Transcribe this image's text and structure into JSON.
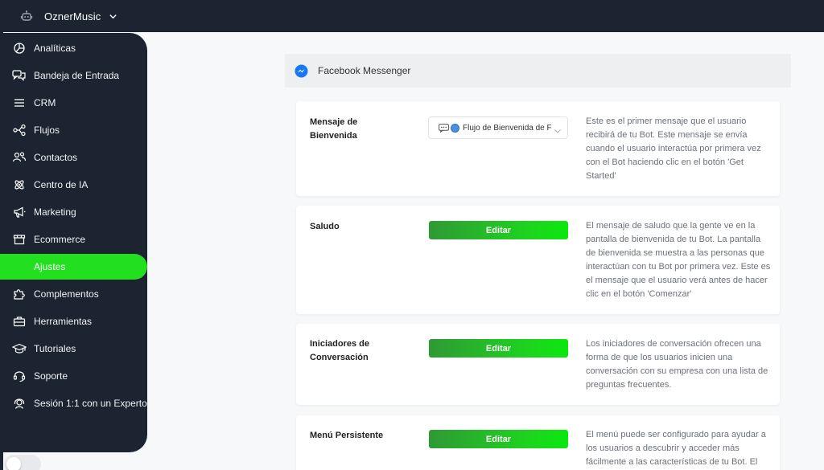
{
  "topbar": {
    "workspace_name": "OznerMusic",
    "workspace_icon": "bot-icon",
    "dropdown_icon": "chevron-down-icon"
  },
  "sidebar": {
    "items": [
      {
        "label": "Analíticas",
        "icon": "pie-chart-icon"
      },
      {
        "label": "Bandeja de Entrada",
        "icon": "chat-bubbles-icon"
      },
      {
        "label": "CRM",
        "icon": "list-icon"
      },
      {
        "label": "Flujos",
        "icon": "flow-nodes-icon"
      },
      {
        "label": "Contactos",
        "icon": "users-icon"
      },
      {
        "label": "Centro de IA",
        "icon": "ai-atom-icon"
      },
      {
        "label": "Marketing",
        "icon": "megaphone-icon"
      },
      {
        "label": "Ecommerce",
        "icon": "store-icon"
      },
      {
        "label": "Ajustes",
        "icon": "",
        "active": true
      },
      {
        "label": "Complementos",
        "icon": "puzzle-icon"
      },
      {
        "label": "Herramientas",
        "icon": "toolbox-icon"
      },
      {
        "label": "Tutoriales",
        "icon": "graduation-cap-icon"
      },
      {
        "label": "Soporte",
        "icon": "support-headset-icon"
      },
      {
        "label": "Sesión 1:1 con un Experto",
        "icon": "expert-headset-icon"
      }
    ],
    "active_color": "#22e01f",
    "background_color": "#1c2431"
  },
  "channel": {
    "title": "Facebook Messenger",
    "icon": "messenger-icon"
  },
  "cards": {
    "welcome": {
      "label": "Mensaje de Bienvenida",
      "selected_flow": "Flujo de Bienvenida de FB",
      "description": "Este es el primer mensaje que el usuario recibirá de tu Bot. Este mensaje se envía cuando el usuario interactúa por primera vez con el Bot haciendo clic en el botón 'Get Started'"
    },
    "greeting": {
      "label": "Saludo",
      "button": "Editar",
      "description": "El mensaje de saludo que la gente ve en la pantalla de bienvenida de tu Bot. La pantalla de bienvenida se muestra a las personas que interactúan con tu Bot por primera vez. Este es el mensaje que el usuario verá antes de hacer clic en el botón 'Comenzar'"
    },
    "starters": {
      "label": "Iniciadores de Conversación",
      "button": "Editar",
      "description": "Los iniciadores de conversación ofrecen una forma de que los usuarios inicien una conversación con su empresa con una lista de preguntas frecuentes."
    },
    "menu": {
      "label": "Menú Persistente",
      "button": "Editar",
      "description": "El menú puede ser configurado para ayudar a los usuarios a descubrir y acceder más fácilmente a las características de tu Bot. El"
    }
  },
  "colors": {
    "button_gradient_start": "#2f9a35",
    "button_gradient_end": "#0be80f",
    "messenger_blue": "#1877f2"
  },
  "toggle": {
    "state": "off"
  }
}
